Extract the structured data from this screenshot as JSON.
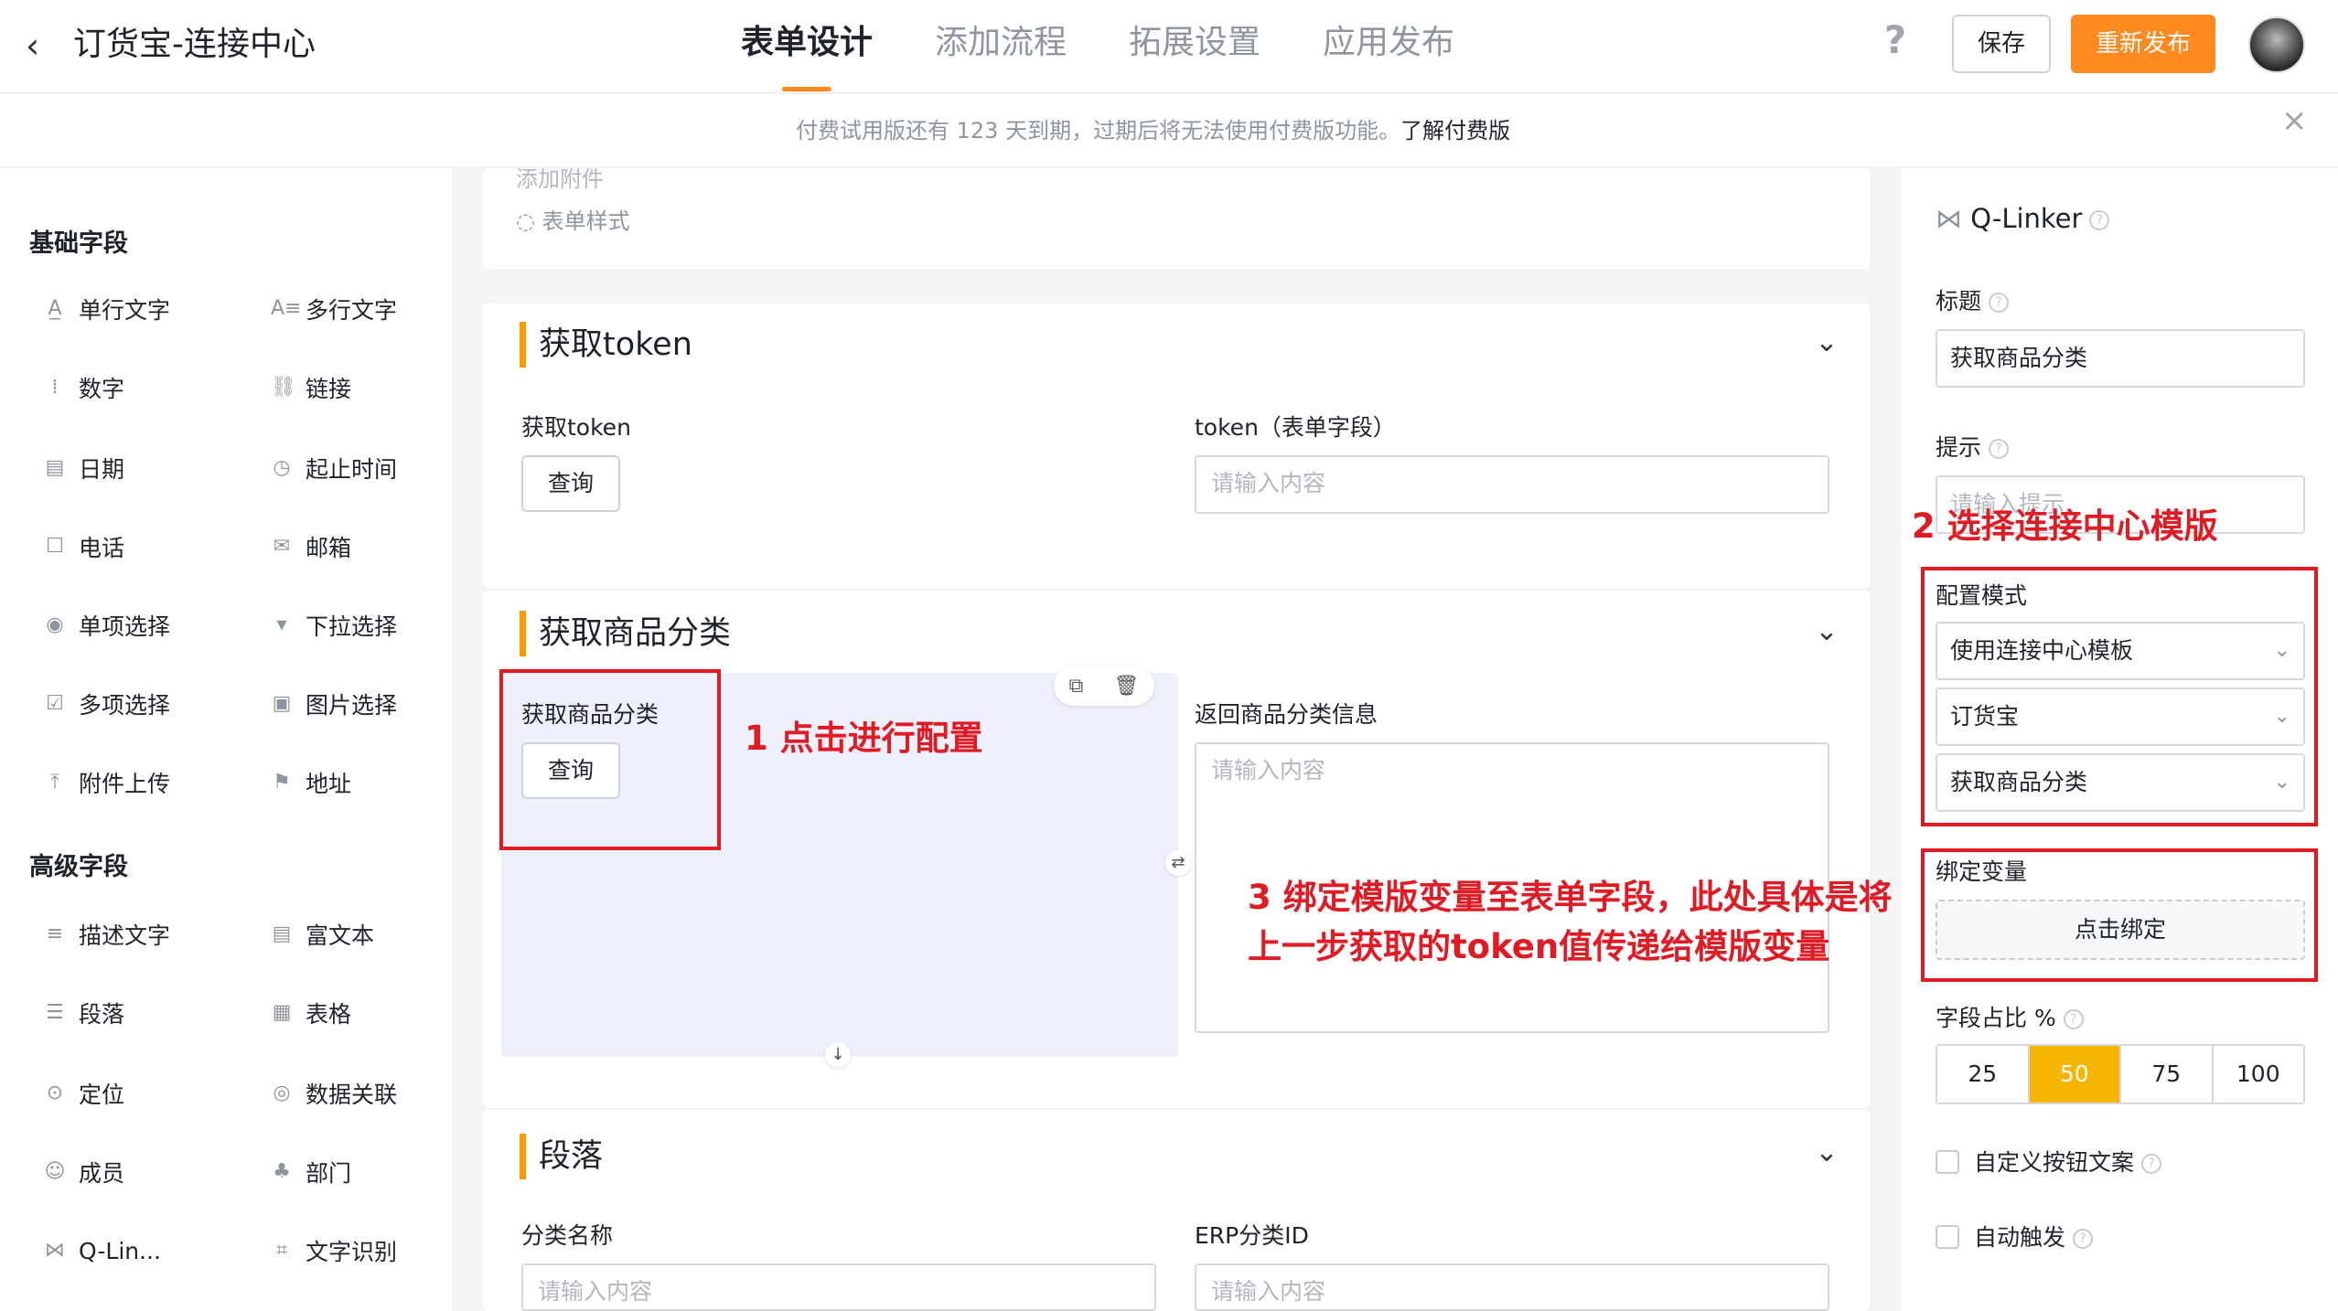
{
  "header": {
    "back": "‹",
    "title": "订货宝-连接中心",
    "tabs": [
      {
        "label": "表单设计"
      },
      {
        "label": "添加流程"
      },
      {
        "label": "拓展设置"
      },
      {
        "label": "应用发布"
      }
    ],
    "help": "?",
    "save": "保存",
    "publish": "重新发布"
  },
  "banner": {
    "text": "付费试用版还有 123 天到期，过期后将无法使用付费版功能。",
    "link": "了解付费版",
    "close": "×"
  },
  "left": {
    "basic_title": "基础字段",
    "basic": [
      {
        "icon": "A̲",
        "label": "单行文字"
      },
      {
        "icon": "A≡",
        "label": "多行文字"
      },
      {
        "icon": "⁞",
        "label": "数字"
      },
      {
        "icon": "⛓",
        "label": "链接"
      },
      {
        "icon": "▤",
        "label": "日期"
      },
      {
        "icon": "◷",
        "label": "起止时间"
      },
      {
        "icon": "☐",
        "label": "电话"
      },
      {
        "icon": "✉",
        "label": "邮箱"
      },
      {
        "icon": "◉",
        "label": "单项选择"
      },
      {
        "icon": "▾",
        "label": "下拉选择"
      },
      {
        "icon": "☑",
        "label": "多项选择"
      },
      {
        "icon": "▣",
        "label": "图片选择"
      },
      {
        "icon": "⤒",
        "label": "附件上传"
      },
      {
        "icon": "⚑",
        "label": "地址"
      }
    ],
    "adv_title": "高级字段",
    "advanced": [
      {
        "icon": "≡",
        "label": "描述文字"
      },
      {
        "icon": "▤",
        "label": "富文本"
      },
      {
        "icon": "☰",
        "label": "段落"
      },
      {
        "icon": "▦",
        "label": "表格"
      },
      {
        "icon": "⊙",
        "label": "定位"
      },
      {
        "icon": "◎",
        "label": "数据关联"
      },
      {
        "icon": "☺",
        "label": "成员"
      },
      {
        "icon": "♣",
        "label": "部门"
      },
      {
        "icon": "⋈",
        "label": "Q-Lin..."
      },
      {
        "icon": "⌗",
        "label": "文字识别"
      }
    ]
  },
  "center": {
    "top_item_partial": "添加附件",
    "top_item": "表单样式",
    "sec1": {
      "title": "获取token",
      "f1_label": "获取token",
      "f1_btn": "查询",
      "f2_label": "token（表单字段）",
      "f2_placeholder": "请输入内容"
    },
    "sec2": {
      "title": "获取商品分类",
      "f1_label": "获取商品分类",
      "f1_btn": "查询",
      "f2_label": "返回商品分类信息",
      "f2_placeholder": "请输入内容"
    },
    "sec3": {
      "title": "段落",
      "f1_label": "分类名称",
      "f1_placeholder": "请输入内容",
      "f2_label": "ERP分类ID",
      "f2_placeholder": "请输入内容"
    }
  },
  "right": {
    "component": "Q-Linker",
    "title_label": "标题",
    "title_value": "获取商品分类",
    "hint_label": "提示",
    "hint_placeholder": "请输入提示",
    "mode_label": "配置模式",
    "mode_value": "使用连接中心模板",
    "app_value": "订货宝",
    "template_value": "获取商品分类",
    "bind_label": "绑定变量",
    "bind_btn": "点击绑定",
    "ratio_label": "字段占比 %",
    "ratios": [
      "25",
      "50",
      "75",
      "100"
    ],
    "ratio_selected": "50",
    "custom_btn_text": "自定义按钮文案",
    "auto_trigger": "自动触发"
  },
  "annotations": {
    "a1": "1 点击进行配置",
    "a2": "2 选择连接中心模版",
    "a3_line1": "3 绑定模版变量至表单字段，此处具体是将",
    "a3_line2": "上一步获取的token值传递给模版变量"
  },
  "colors": {
    "accent": "#ff8a1f",
    "section_bar": "#ff9800",
    "annotation": "#e01b24",
    "ratio_on": "#f7b500"
  }
}
